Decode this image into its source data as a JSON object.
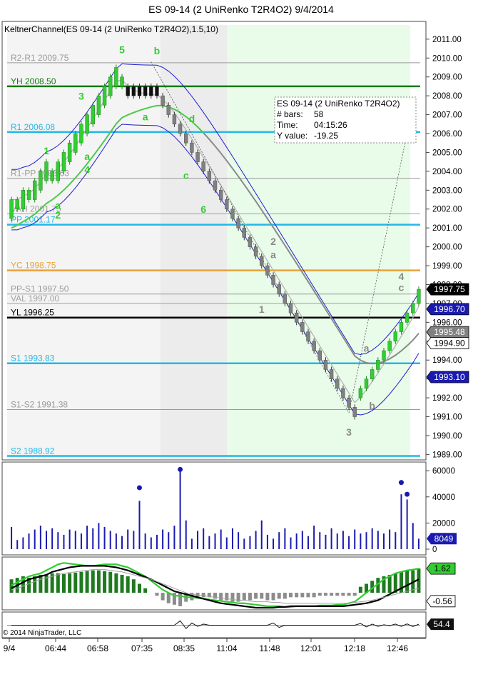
{
  "window_title": "ES 09-14 (2 UniRenko T2R4O2)  9/4/2014",
  "indicator_label": "KeltnerChannel(ES 09-14 (2 UniRenko T2R4O2),1.5,10)",
  "copyright": "© 2014 NinjaTrader, LLC",
  "colors": {
    "up_bar": "#32cd32",
    "down_bar": "#808080",
    "keltner": "#1e1ecf",
    "ema_green": "#4cc94c",
    "ema_gray": "#8a8a8a",
    "cyan": "#22b8e8",
    "dark_green": "#137a13",
    "orange": "#e8a33a",
    "black": "#000000",
    "volume": "#1a1ab0"
  },
  "chart_data": [
    {
      "type": "candlestick",
      "title": "ES 09-14 (2 UniRenko T2R4O2)  9/4/2014",
      "ylim": [
        1988.75,
        2011.75
      ],
      "y_ticks": [
        "2011.00",
        "2010.00",
        "2009.00",
        "2008.00",
        "2007.00",
        "2006.00",
        "2005.00",
        "2004.00",
        "2003.00",
        "2002.00",
        "2001.00",
        "2000.00",
        "1999.00",
        "1998.00",
        "1997.00",
        "1996.00",
        "1995.00",
        "1994.00",
        "1993.00",
        "1992.00",
        "1991.00",
        "1990.00",
        "1989.00"
      ],
      "x_ticks": [
        "9/4",
        "06:44",
        "06:58",
        "07:35",
        "08:35",
        "11:04",
        "11:48",
        "12:01",
        "12:18",
        "12:46"
      ],
      "level_lines": [
        {
          "label": "R2-R1 2009.75",
          "value": 2009.75,
          "color": "#9a9a9a"
        },
        {
          "label": "YH 2008.50",
          "value": 2008.5,
          "color": "#137a13"
        },
        {
          "label": "R1 2006.08",
          "value": 2006.08,
          "color": "#22b8e8"
        },
        {
          "label": "R1-PP 2003.63",
          "value": 2003.63,
          "color": "#9a9a9a"
        },
        {
          "label": "VAH 2001.75",
          "value": 2001.75,
          "color": "#a0a0a0"
        },
        {
          "label": "PP 2001.17",
          "value": 2001.17,
          "color": "#22b8e8"
        },
        {
          "label": "YC 1998.75",
          "value": 1998.75,
          "color": "#e8a33a"
        },
        {
          "label": "PP-S1 1997.50",
          "value": 1997.5,
          "color": "#9a9a9a"
        },
        {
          "label": "VAL 1997.00",
          "value": 1997.0,
          "color": "#a0a0a0"
        },
        {
          "label": "YL 1996.25",
          "value": 1996.25,
          "color": "#000000"
        },
        {
          "label": "S1 1993.83",
          "value": 1993.83,
          "color": "#22b8e8"
        },
        {
          "label": "S1-S2 1991.38",
          "value": 1991.38,
          "color": "#9a9a9a"
        },
        {
          "label": "S2 1988.92",
          "value": 1988.92,
          "color": "#22b8e8"
        }
      ],
      "price_tags": [
        {
          "label": "1997.75",
          "value": 1997.75,
          "bg": "#000000"
        },
        {
          "label": "1996.70",
          "value": 1996.7,
          "bg": "#1a1ab0"
        },
        {
          "label": "1995.48",
          "value": 1995.48,
          "bg": "#808080"
        },
        {
          "label": "1994.90",
          "value": 1994.9,
          "bg": "#ffffff"
        },
        {
          "label": "1993.10",
          "value": 1993.1,
          "bg": "#1a1ab0"
        }
      ],
      "wave_labels": [
        {
          "text": "5",
          "bar": 19,
          "value": 2010.25,
          "color": "#32cd32"
        },
        {
          "text": "b",
          "bar": 25,
          "value": 2010.2,
          "color": "#32cd32"
        },
        {
          "text": "3",
          "bar": 12,
          "value": 2007.8,
          "color": "#32cd32"
        },
        {
          "text": "a",
          "bar": 23,
          "value": 2006.7,
          "color": "#32cd32"
        },
        {
          "text": "d",
          "bar": 31,
          "value": 2006.6,
          "color": "#32cd32"
        },
        {
          "text": "1",
          "bar": 6,
          "value": 2004.9,
          "color": "#32cd32"
        },
        {
          "text": "a",
          "bar": 13,
          "value": 2004.6,
          "color": "#32cd32"
        },
        {
          "text": "4",
          "bar": 13,
          "value": 2003.9,
          "color": "#32cd32"
        },
        {
          "text": "c",
          "bar": 30,
          "value": 2003.6,
          "color": "#32cd32"
        },
        {
          "text": "6",
          "bar": 33,
          "value": 2001.8,
          "color": "#32cd32"
        },
        {
          "text": "a",
          "bar": 8,
          "value": 2002.0,
          "color": "#32cd32"
        },
        {
          "text": "2",
          "bar": 8,
          "value": 2001.5,
          "color": "#32cd32"
        },
        {
          "text": "2",
          "bar": 45,
          "value": 2000.1,
          "color": "#8a8a8a"
        },
        {
          "text": "a",
          "bar": 45,
          "value": 1999.4,
          "color": "#8a8a8a"
        },
        {
          "text": "1",
          "bar": 43,
          "value": 1996.5,
          "color": "#8a8a8a"
        },
        {
          "text": "4",
          "bar": 67,
          "value": 1998.25,
          "color": "#8a8a8a"
        },
        {
          "text": "c",
          "bar": 67,
          "value": 1997.65,
          "color": "#8a8a8a"
        },
        {
          "text": "a",
          "bar": 61,
          "value": 1994.45,
          "color": "#8a8a8a"
        },
        {
          "text": "b",
          "bar": 62,
          "value": 1991.4,
          "color": "#8a8a8a"
        },
        {
          "text": "3",
          "bar": 58,
          "value": 1990.0,
          "color": "#8a8a8a"
        }
      ],
      "info_box": {
        "lines": [
          "ES 09-14 (2 UniRenko T2R4O2)",
          "# bars:",
          "Time:",
          "Y value:"
        ],
        "values": [
          "",
          "58",
          "04:15:26",
          "-19.25"
        ]
      },
      "bars": [
        {
          "o": 2001.5,
          "c": 2002.5
        },
        {
          "o": 2002.0,
          "c": 2002.5
        },
        {
          "o": 2002.0,
          "c": 2003.0
        },
        {
          "o": 2002.5,
          "c": 2003.0
        },
        {
          "o": 2002.5,
          "c": 2003.5
        },
        {
          "o": 2003.0,
          "c": 2004.0
        },
        {
          "o": 2003.5,
          "c": 2004.5
        },
        {
          "o": 2003.5,
          "c": 2004.0
        },
        {
          "o": 2003.5,
          "c": 2004.5
        },
        {
          "o": 2004.0,
          "c": 2005.0
        },
        {
          "o": 2004.5,
          "c": 2005.5
        },
        {
          "o": 2005.0,
          "c": 2006.0
        },
        {
          "o": 2005.5,
          "c": 2006.5
        },
        {
          "o": 2006.0,
          "c": 2007.0
        },
        {
          "o": 2006.5,
          "c": 2007.5
        },
        {
          "o": 2007.0,
          "c": 2008.0
        },
        {
          "o": 2007.5,
          "c": 2008.5
        },
        {
          "o": 2008.0,
          "c": 2009.0
        },
        {
          "o": 2008.5,
          "c": 2009.5
        },
        {
          "o": 2008.5,
          "c": 2009.0
        },
        {
          "o": 2008.5,
          "c": 2008.0
        },
        {
          "o": 2008.5,
          "c": 2008.0
        },
        {
          "o": 2008.5,
          "c": 2008.0
        },
        {
          "o": 2008.5,
          "c": 2008.0
        },
        {
          "o": 2008.5,
          "c": 2008.0
        },
        {
          "o": 2008.5,
          "c": 2008.0
        },
        {
          "o": 2008.0,
          "c": 2007.5
        },
        {
          "o": 2007.5,
          "c": 2007.0
        },
        {
          "o": 2007.0,
          "c": 2006.5
        },
        {
          "o": 2006.5,
          "c": 2006.0
        },
        {
          "o": 2006.0,
          "c": 2005.5
        },
        {
          "o": 2005.5,
          "c": 2005.0
        },
        {
          "o": 2005.0,
          "c": 2004.5
        },
        {
          "o": 2004.5,
          "c": 2004.0
        },
        {
          "o": 2004.0,
          "c": 2003.5
        },
        {
          "o": 2003.5,
          "c": 2003.0
        },
        {
          "o": 2003.0,
          "c": 2002.5
        },
        {
          "o": 2002.5,
          "c": 2002.0
        },
        {
          "o": 2002.0,
          "c": 2001.5
        },
        {
          "o": 2001.5,
          "c": 2001.0
        },
        {
          "o": 2001.0,
          "c": 2000.5
        },
        {
          "o": 2000.5,
          "c": 2000.0
        },
        {
          "o": 2000.0,
          "c": 1999.5
        },
        {
          "o": 1999.5,
          "c": 1999.0
        },
        {
          "o": 1999.0,
          "c": 1998.5
        },
        {
          "o": 1998.5,
          "c": 1998.0
        },
        {
          "o": 1998.0,
          "c": 1997.5
        },
        {
          "o": 1997.5,
          "c": 1997.0
        },
        {
          "o": 1997.0,
          "c": 1996.5
        },
        {
          "o": 1996.5,
          "c": 1996.0
        },
        {
          "o": 1996.0,
          "c": 1995.5
        },
        {
          "o": 1995.5,
          "c": 1995.0
        },
        {
          "o": 1995.0,
          "c": 1994.5
        },
        {
          "o": 1994.5,
          "c": 1994.0
        },
        {
          "o": 1994.0,
          "c": 1993.5
        },
        {
          "o": 1993.5,
          "c": 1993.0
        },
        {
          "o": 1993.0,
          "c": 1992.5
        },
        {
          "o": 1992.5,
          "c": 1992.0
        },
        {
          "o": 1992.0,
          "c": 1991.5
        },
        {
          "o": 1991.5,
          "c": 1991.0
        },
        {
          "o": 1992.0,
          "c": 1992.5
        },
        {
          "o": 1992.5,
          "c": 1993.0
        },
        {
          "o": 1993.0,
          "c": 1993.5
        },
        {
          "o": 1993.5,
          "c": 1994.0
        },
        {
          "o": 1994.0,
          "c": 1994.5
        },
        {
          "o": 1994.5,
          "c": 1995.0
        },
        {
          "o": 1995.0,
          "c": 1995.5
        },
        {
          "o": 1995.5,
          "c": 1996.0
        },
        {
          "o": 1996.0,
          "c": 1996.5
        },
        {
          "o": 1996.5,
          "c": 1997.0
        },
        {
          "o": 1997.0,
          "c": 1997.75
        }
      ]
    },
    {
      "type": "bar",
      "title": "",
      "ylim": [
        0,
        65000
      ],
      "y_ticks": [
        "60000",
        "40000",
        "20000",
        "0"
      ],
      "last_value_tag": "8049",
      "values": [
        17000,
        7000,
        9000,
        12000,
        15000,
        18000,
        14000,
        16000,
        13000,
        11000,
        15000,
        14000,
        12000,
        18000,
        16000,
        20000,
        17000,
        14000,
        12000,
        10000,
        15000,
        14000,
        37000,
        12000,
        9000,
        11000,
        15000,
        13000,
        18000,
        60000,
        22000,
        8000,
        14000,
        16000,
        10000,
        12000,
        15000,
        9000,
        16000,
        13000,
        8000,
        10000,
        14000,
        22000,
        11000,
        8000,
        13000,
        16000,
        9000,
        12000,
        14000,
        10000,
        18000,
        13000,
        11000,
        16000,
        12000,
        14000,
        10000,
        15000,
        12000,
        13000,
        16000,
        14000,
        12000,
        15000,
        13000,
        42000,
        38000,
        20000,
        8049
      ],
      "markers": [
        {
          "bar": 22,
          "value": 47000
        },
        {
          "bar": 29,
          "value": 61000
        },
        {
          "bar": 67,
          "value": 51000
        },
        {
          "bar": 68,
          "value": 42000
        }
      ]
    },
    {
      "type": "line",
      "title": "",
      "ylim": [
        -1.0,
        2.2
      ],
      "tags": [
        {
          "label": "1.62",
          "value": 1.62,
          "bg": "#32cd32"
        },
        {
          "label": "-0.56",
          "value": -0.56,
          "bg": "#ffffff"
        }
      ],
      "histogram": [
        0.9,
        1.0,
        1.1,
        1.0,
        1.1,
        1.2,
        1.2,
        1.3,
        1.3,
        1.25,
        1.3,
        1.35,
        1.4,
        1.45,
        1.5,
        1.5,
        1.45,
        1.4,
        1.3,
        1.2,
        1.1,
        0.9,
        0.6,
        0.3,
        0.0,
        -0.2,
        -0.5,
        -0.7,
        -0.8,
        -0.9,
        -0.6,
        -0.5,
        -0.4,
        -0.3,
        -0.3,
        -0.4,
        -0.5,
        -0.5,
        -0.6,
        -0.6,
        -0.5,
        -0.5,
        -0.4,
        -0.4,
        -0.5,
        -0.5,
        -0.4,
        -0.4,
        -0.3,
        -0.3,
        -0.3,
        -0.3,
        -0.3,
        -0.2,
        -0.2,
        -0.2,
        -0.2,
        -0.2,
        -0.2,
        -0.2,
        0.4,
        0.6,
        0.8,
        1.0,
        1.1,
        1.2,
        1.3,
        1.4,
        1.5,
        1.5,
        1.62
      ],
      "series": [
        {
          "values": [
            0.5,
            0.7,
            0.9,
            1.1,
            1.2,
            1.3,
            1.5,
            1.7,
            1.9,
            2.0,
            1.95,
            1.9,
            1.85,
            1.8,
            1.8,
            1.85,
            1.9,
            1.9,
            1.9,
            1.8,
            1.7,
            1.5,
            1.3,
            1.1,
            0.8,
            0.5,
            0.2,
            0.0,
            -0.2,
            -0.2,
            -0.3,
            -0.3,
            -0.35,
            -0.4,
            -0.45,
            -0.5,
            -0.55,
            -0.6,
            -0.65,
            -0.7,
            -0.7,
            -0.75,
            -0.8,
            -0.85,
            -0.9,
            -0.9,
            -0.9,
            -0.95,
            -0.95,
            -0.9,
            -0.9,
            -0.9,
            -0.9,
            -0.85,
            -0.85,
            -0.85,
            -0.8,
            -0.8,
            -0.7,
            -0.6,
            -0.3,
            0.0,
            0.3,
            0.6,
            0.9,
            1.1,
            1.3,
            1.4,
            1.5,
            1.55,
            1.62
          ],
          "color": "#32cd32"
        },
        {
          "values": [
            0.3,
            0.5,
            0.7,
            0.9,
            1.0,
            1.1,
            1.2,
            1.4,
            1.5,
            1.6,
            1.7,
            1.75,
            1.8,
            1.8,
            1.8,
            1.8,
            1.8,
            1.75,
            1.7,
            1.6,
            1.5,
            1.35,
            1.2,
            1.05,
            0.9,
            0.7,
            0.5,
            0.3,
            0.1,
            0.0,
            -0.1,
            -0.2,
            -0.3,
            -0.4,
            -0.5,
            -0.6,
            -0.7,
            -0.75,
            -0.8,
            -0.85,
            -0.9,
            -0.95,
            -1.0,
            -1.0,
            -1.0,
            -1.0,
            -0.95,
            -0.95,
            -0.9,
            -0.9,
            -0.9,
            -0.9,
            -0.9,
            -0.9,
            -0.9,
            -0.9,
            -0.9,
            -0.9,
            -0.85,
            -0.8,
            -0.75,
            -0.7,
            -0.6,
            -0.5,
            -0.3,
            -0.1,
            0.1,
            0.3,
            0.5,
            0.7,
            0.9
          ],
          "color": "#000000"
        },
        {
          "values": [
            0.2,
            0.3,
            0.45,
            0.6,
            0.75,
            0.9,
            1.0,
            1.1,
            1.2,
            1.3,
            1.35,
            1.4,
            1.45,
            1.5,
            1.55,
            1.55,
            1.55,
            1.5,
            1.45,
            1.4,
            1.3,
            1.2,
            1.1,
            1.0,
            0.9,
            0.75,
            0.6,
            0.45,
            0.3,
            0.15,
            0.0,
            -0.1,
            -0.15,
            -0.2,
            -0.25,
            -0.3,
            -0.35,
            -0.4,
            -0.45,
            -0.5,
            -0.5,
            -0.55,
            -0.6,
            -0.6,
            -0.6,
            -0.65,
            -0.65,
            -0.7,
            -0.7,
            -0.7,
            -0.7,
            -0.7,
            -0.7,
            -0.7,
            -0.7,
            -0.7,
            -0.7,
            -0.7,
            -0.7,
            -0.65,
            -0.6,
            -0.56,
            -0.5,
            -0.4,
            -0.3,
            -0.2,
            -0.1,
            0.0,
            0.1,
            0.2,
            0.3
          ],
          "color": "#a0a0a0"
        }
      ]
    },
    {
      "type": "line",
      "title": "",
      "ylim": [
        0,
        100
      ],
      "last_value_tag": "54.4",
      "values": [
        50,
        50,
        50,
        50,
        50,
        50,
        50,
        50,
        50,
        50,
        50,
        50,
        50,
        50,
        50,
        50,
        50,
        50,
        50,
        50,
        50,
        50,
        50,
        50,
        50,
        50,
        50,
        50,
        50,
        70,
        35,
        60,
        45,
        55,
        50,
        50,
        50,
        50,
        50,
        50,
        50,
        50,
        50,
        50,
        50,
        60,
        40,
        50,
        50,
        50,
        50,
        50,
        50,
        50,
        50,
        50,
        50,
        50,
        50,
        50,
        58,
        42,
        55,
        45,
        52,
        48,
        55,
        45,
        56,
        44,
        54.4
      ]
    }
  ]
}
